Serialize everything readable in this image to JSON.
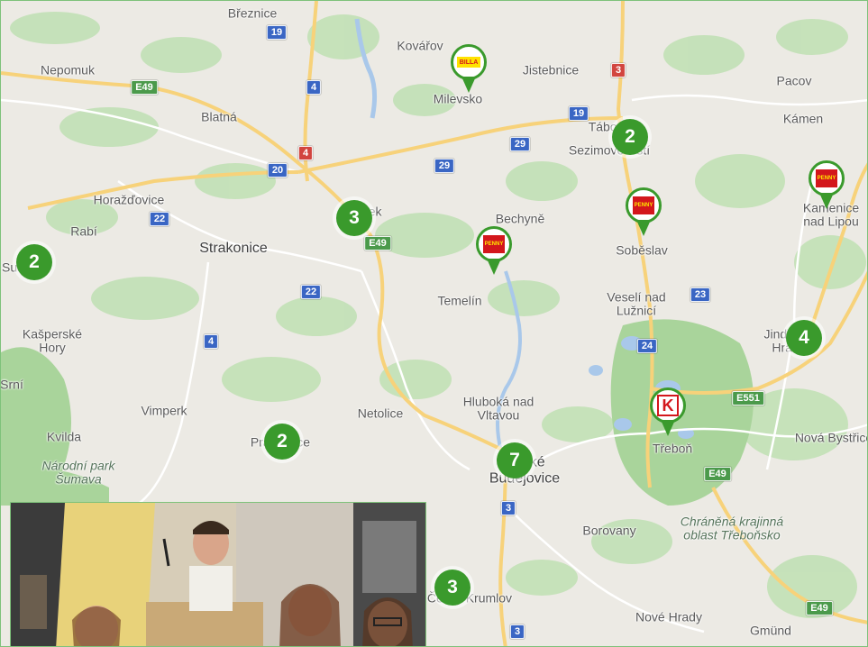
{
  "places": [
    {
      "id": "breznice",
      "label": "Březnice"
    },
    {
      "id": "kovarov",
      "label": "Kovářov"
    },
    {
      "id": "nepomuk",
      "label": "Nepomuk"
    },
    {
      "id": "jistebnice",
      "label": "Jistebnice"
    },
    {
      "id": "pacov",
      "label": "Pacov"
    },
    {
      "id": "milevsko",
      "label": "Milevsko"
    },
    {
      "id": "blatna",
      "label": "Blatná"
    },
    {
      "id": "kamen",
      "label": "Kámen"
    },
    {
      "id": "tabor",
      "label": "Tábor"
    },
    {
      "id": "sezimovo",
      "label": "Sezimovo Ústí"
    },
    {
      "id": "horazdovice",
      "label": "Horažďovice"
    },
    {
      "id": "pisek",
      "label": "Písek"
    },
    {
      "id": "bechyne",
      "label": "Bechyně"
    },
    {
      "id": "kamenice",
      "label": "Kamenice nad Lipou"
    },
    {
      "id": "rabi",
      "label": "Rabí"
    },
    {
      "id": "strakonice",
      "label": "Strakonice"
    },
    {
      "id": "sobeslav",
      "label": "Soběslav"
    },
    {
      "id": "susice",
      "label": "Sušice"
    },
    {
      "id": "temelin",
      "label": "Temelín"
    },
    {
      "id": "veseli",
      "label": "Veselí nad Lužnicí"
    },
    {
      "id": "kasperske",
      "label": "Kašperské Hory"
    },
    {
      "id": "jindrichuv",
      "label": "Jindřichův Hradec"
    },
    {
      "id": "srni",
      "label": "Srní"
    },
    {
      "id": "hluboka",
      "label": "Hluboká nad Vltavou"
    },
    {
      "id": "vimperk",
      "label": "Vimperk"
    },
    {
      "id": "netolice",
      "label": "Netolice"
    },
    {
      "id": "kvilda",
      "label": "Kvilda"
    },
    {
      "id": "prachatice",
      "label": "Prachatice"
    },
    {
      "id": "trebon",
      "label": "Třeboň"
    },
    {
      "id": "novabystrice",
      "label": "Nová Bystřice"
    },
    {
      "id": "narodnipark",
      "label": "Národní park Šumava"
    },
    {
      "id": "budejovice",
      "label": "České Budějovice"
    },
    {
      "id": "chranena",
      "label": "Chráněná krajinná oblast Třeboňsko"
    },
    {
      "id": "borovany",
      "label": "Borovany"
    },
    {
      "id": "krumlov",
      "label": "Český Krumlov"
    },
    {
      "id": "novehrady",
      "label": "Nové Hrady"
    },
    {
      "id": "gmund",
      "label": "Gmünd"
    }
  ],
  "road_shields": [
    {
      "id": "r19a",
      "label": "19",
      "color": "blue"
    },
    {
      "id": "e49a",
      "label": "E49",
      "color": "green"
    },
    {
      "id": "r4a",
      "label": "4",
      "color": "blue"
    },
    {
      "id": "r3a",
      "label": "3",
      "color": "red"
    },
    {
      "id": "r19b",
      "label": "19",
      "color": "blue"
    },
    {
      "id": "r29a",
      "label": "29",
      "color": "blue"
    },
    {
      "id": "r4b",
      "label": "4",
      "color": "red"
    },
    {
      "id": "r20",
      "label": "20",
      "color": "blue"
    },
    {
      "id": "r29b",
      "label": "29",
      "color": "blue"
    },
    {
      "id": "r22a",
      "label": "22",
      "color": "blue"
    },
    {
      "id": "e49b",
      "label": "E49",
      "color": "green"
    },
    {
      "id": "r22b",
      "label": "22",
      "color": "blue"
    },
    {
      "id": "r23",
      "label": "23",
      "color": "blue"
    },
    {
      "id": "r4c",
      "label": "4",
      "color": "blue"
    },
    {
      "id": "r24",
      "label": "24",
      "color": "blue"
    },
    {
      "id": "e551",
      "label": "E551",
      "color": "green"
    },
    {
      "id": "e49c",
      "label": "E49",
      "color": "green"
    },
    {
      "id": "r3b",
      "label": "3",
      "color": "blue"
    },
    {
      "id": "r3c",
      "label": "3",
      "color": "blue"
    },
    {
      "id": "e49d",
      "label": "E49",
      "color": "green"
    }
  ],
  "clusters": [
    {
      "id": "c-tabor",
      "count": "2"
    },
    {
      "id": "c-pisek",
      "count": "3"
    },
    {
      "id": "c-susice",
      "count": "2"
    },
    {
      "id": "c-jindrichuv",
      "count": "4"
    },
    {
      "id": "c-prachatice",
      "count": "2"
    },
    {
      "id": "c-budejovice",
      "count": "7"
    },
    {
      "id": "c-krumlov",
      "count": "3"
    }
  ],
  "store_pins": [
    {
      "id": "pin-milevsko",
      "brand": "billa",
      "logo_text": "BILLA"
    },
    {
      "id": "pin-kamenice",
      "brand": "penny",
      "logo_text": "PENNY"
    },
    {
      "id": "pin-sobeslav",
      "brand": "penny",
      "logo_text": "PENNY"
    },
    {
      "id": "pin-bechyne",
      "brand": "penny",
      "logo_text": "PENNY"
    },
    {
      "id": "pin-trebon",
      "brand": "kaufland",
      "logo_text": "K"
    }
  ],
  "colors": {
    "cluster": "#3a9a2c",
    "land": "#eceae4",
    "forest": "#b9dcae",
    "water": "#a9c8ea",
    "road_major": "#f7d27a"
  }
}
